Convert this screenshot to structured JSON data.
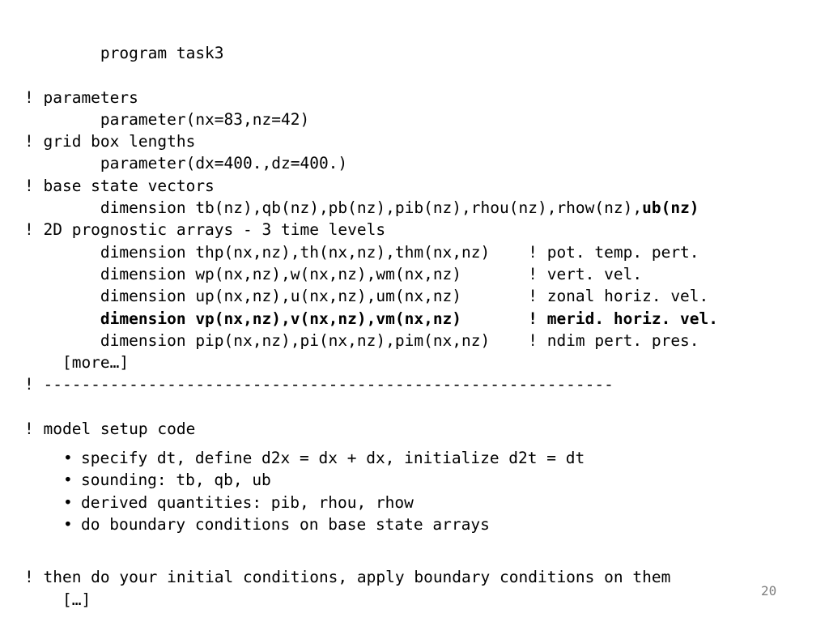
{
  "slide": {
    "page_number": "20",
    "code_lines": [
      {
        "text": "        program task3",
        "bold": false
      },
      {
        "text": "",
        "bold": false
      },
      {
        "text": "! parameters",
        "bold": false
      },
      {
        "text": "        parameter(nx=83,nz=42)",
        "bold": false
      },
      {
        "text": "! grid box lengths",
        "bold": false
      },
      {
        "text": "        parameter(dx=400.,dz=400.)",
        "bold": false
      },
      {
        "text": "! base state vectors",
        "bold": false
      },
      {
        "text": "        dimension tb(nz),qb(nz),pb(nz),pib(nz),rhou(nz),rhow(nz),",
        "bold_tail": "ub(nz)"
      },
      {
        "text": "! 2D prognostic arrays - 3 time levels",
        "bold": false
      },
      {
        "text": "        dimension thp(nx,nz),th(nx,nz),thm(nx,nz)    ! pot. temp. pert.",
        "bold": false
      },
      {
        "text": "        dimension wp(nx,nz),w(nx,nz),wm(nx,nz)       ! vert. vel.",
        "bold": false
      },
      {
        "text": "        dimension up(nx,nz),u(nx,nz),um(nx,nz)       ! zonal horiz. vel.",
        "bold": false
      },
      {
        "text": "        dimension vp(nx,nz),v(nx,nz),vm(nx,nz)       ! merid. horiz. vel.",
        "bold": true
      },
      {
        "text": "        dimension pip(nx,nz),pi(nx,nz),pim(nx,nz)    ! ndim pert. pres.",
        "bold": false
      },
      {
        "text": "    [more…]",
        "bold": false
      },
      {
        "text": "! ------------------------------------------------------------",
        "bold": false
      },
      {
        "text": "",
        "bold": false
      },
      {
        "text": "! model setup code",
        "bold": false
      }
    ],
    "bullets": [
      {
        "dot": "•",
        "text": "specify dt, define d2x = dx + dx, initialize d2t = dt"
      },
      {
        "dot": "•",
        "text": "sounding: tb, qb, ub"
      },
      {
        "dot": "•",
        "text": "derived quantities: pib, rhou, rhow"
      },
      {
        "dot": "•",
        "text": "do boundary conditions on base state arrays"
      }
    ],
    "closing_lines": [
      {
        "text": "",
        "bold": false
      },
      {
        "text": "! then do your initial conditions, apply boundary conditions on them",
        "bold": false
      },
      {
        "text": "    […]",
        "bold": false
      }
    ]
  }
}
